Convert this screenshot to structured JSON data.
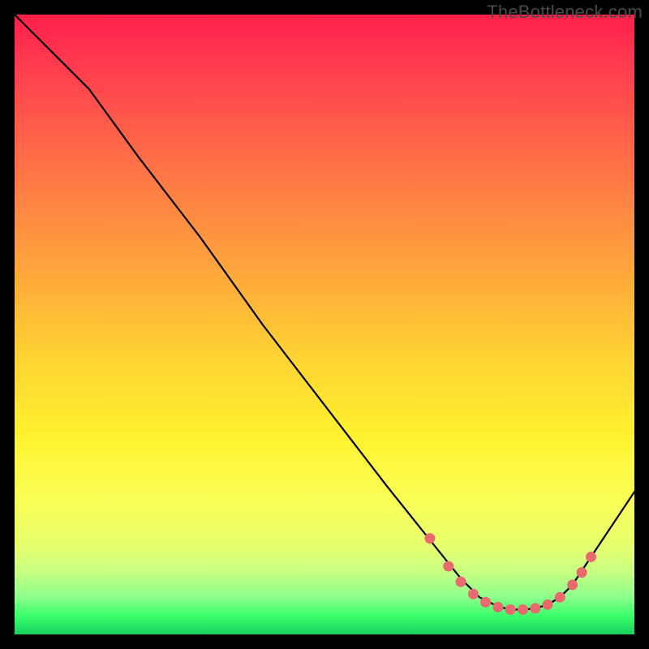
{
  "watermark": {
    "text": "TheBottleneck.com"
  },
  "chart_data": {
    "type": "line",
    "title": "",
    "xlabel": "",
    "ylabel": "",
    "xlim": [
      0,
      100
    ],
    "ylim": [
      0,
      100
    ],
    "series": [
      {
        "name": "bottleneck-curve",
        "x": [
          0,
          6,
          12,
          20,
          30,
          40,
          50,
          60,
          68,
          72,
          75,
          78,
          80,
          82,
          84,
          86,
          88,
          90,
          94,
          100
        ],
        "y": [
          100,
          94,
          88,
          77,
          64,
          50,
          37,
          24,
          14,
          9,
          6,
          4.5,
          4,
          4,
          4.2,
          4.8,
          6,
          8,
          14,
          23
        ]
      }
    ],
    "markers": {
      "name": "annotated-dots",
      "color": "#e86a6f",
      "points": [
        {
          "x": 67,
          "y": 15.5
        },
        {
          "x": 70,
          "y": 11
        },
        {
          "x": 72,
          "y": 8.5
        },
        {
          "x": 74,
          "y": 6.5
        },
        {
          "x": 76,
          "y": 5.2
        },
        {
          "x": 78,
          "y": 4.4
        },
        {
          "x": 80,
          "y": 4
        },
        {
          "x": 82,
          "y": 4
        },
        {
          "x": 84,
          "y": 4.2
        },
        {
          "x": 86,
          "y": 4.8
        },
        {
          "x": 88,
          "y": 6
        },
        {
          "x": 90,
          "y": 8
        },
        {
          "x": 91.5,
          "y": 10
        },
        {
          "x": 93,
          "y": 12.5
        }
      ]
    }
  }
}
